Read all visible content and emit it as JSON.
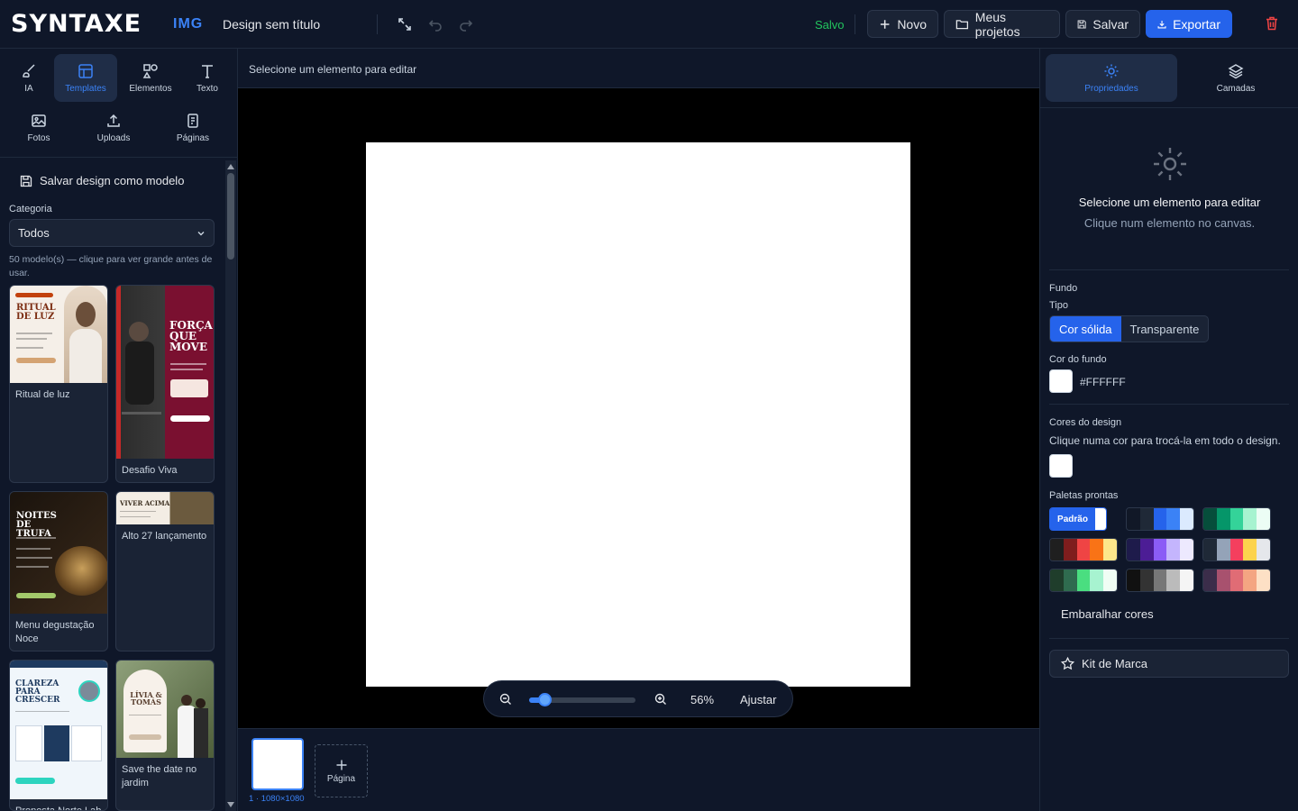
{
  "app": {
    "logo": "SYNTAXE",
    "logo_suffix": "IMG",
    "doc_title": "Design sem título",
    "status": "Salvo",
    "buttons": {
      "new": "Novo",
      "projects": "Meus projetos",
      "save": "Salvar",
      "export": "Exportar"
    }
  },
  "left_panel": {
    "tools": [
      {
        "label": "IA",
        "icon": "brush-icon"
      },
      {
        "label": "Templates",
        "icon": "layout-icon"
      },
      {
        "label": "Elementos",
        "icon": "shapes-icon"
      },
      {
        "label": "Texto",
        "icon": "text-icon"
      },
      {
        "label": "Fotos",
        "icon": "image-icon"
      },
      {
        "label": "Uploads",
        "icon": "upload-icon"
      },
      {
        "label": "Páginas",
        "icon": "pages-icon"
      }
    ],
    "save_model": "Salvar design como modelo",
    "category_label": "Categoria",
    "category_value": "Todos",
    "count_text": "50 modelo(s) — clique para ver grande antes de usar.",
    "templates": [
      {
        "name": "Ritual de luz",
        "title": "RITUAL DE LUZ"
      },
      {
        "name": "Desafio Viva",
        "title": "FORÇA QUE MOVE"
      },
      {
        "name": "Menu degustação Noce",
        "title": "NOITES DE TRUFA"
      },
      {
        "name": "Alto 27 lançamento",
        "title": "VIVER ACIMA"
      },
      {
        "name": "Proposta Norte Lab",
        "title": "CLAREZA PARA CRESCER"
      },
      {
        "name": "Save the date no jardim",
        "title": "LÍVIA & TOMÁS"
      }
    ]
  },
  "canvas": {
    "hint": "Selecione um elemento para editar",
    "zoom_percent": "56%",
    "zoom_value": 0.14,
    "fit_label": "Ajustar",
    "page_label": "1 · 1080×1080",
    "add_page_label": "Página"
  },
  "right_panel": {
    "tabs": [
      "Propriedades",
      "Camadas"
    ],
    "empty_title": "Selecione um elemento para editar",
    "empty_sub": "Clique num elemento no canvas.",
    "background_section": "Fundo",
    "type_label": "Tipo",
    "type_options": [
      "Cor sólida",
      "Transparente"
    ],
    "bg_color_label": "Cor do fundo",
    "bg_color_value": "#FFFFFF",
    "design_colors_label": "Cores do design",
    "design_colors_hint": "Clique numa cor para trocá-la em todo o design.",
    "palettes_label": "Paletas prontas",
    "default_palette": "Padrão",
    "palettes": [
      [
        "#2563eb",
        "#2563eb",
        "#2563eb",
        "#ffffff"
      ],
      [
        "#111827",
        "#1f2937",
        "#2563eb",
        "#3b82f6",
        "#dbeafe"
      ],
      [
        "#064e3b",
        "#059669",
        "#34d399",
        "#a7f3d0",
        "#ecfdf5"
      ],
      [
        "#1f1f1f",
        "#7f1d1d",
        "#ef4444",
        "#f97316",
        "#fde68a"
      ],
      [
        "#1e1b4b",
        "#4c1d95",
        "#8b5cf6",
        "#c4b5fd",
        "#ede9fe"
      ],
      [
        "#1f2937",
        "#94a3b8",
        "#f43f5e",
        "#fcd34d",
        "#e5e7eb"
      ],
      [
        "#1f3d2b",
        "#2f6b4f",
        "#4ade80",
        "#a7f3d0",
        "#f0fdf4"
      ],
      [
        "#111111",
        "#333333",
        "#777777",
        "#bbbbbb",
        "#f5f5f5"
      ],
      [
        "#3b2d4a",
        "#a8516e",
        "#e06c75",
        "#f4a582",
        "#fde0c5"
      ]
    ],
    "shuffle_label": "Embaralhar cores",
    "brand_kit_label": "Kit de Marca"
  },
  "colors": {
    "accent": "#2563eb",
    "success": "#22c55e",
    "danger": "#ef4444"
  }
}
